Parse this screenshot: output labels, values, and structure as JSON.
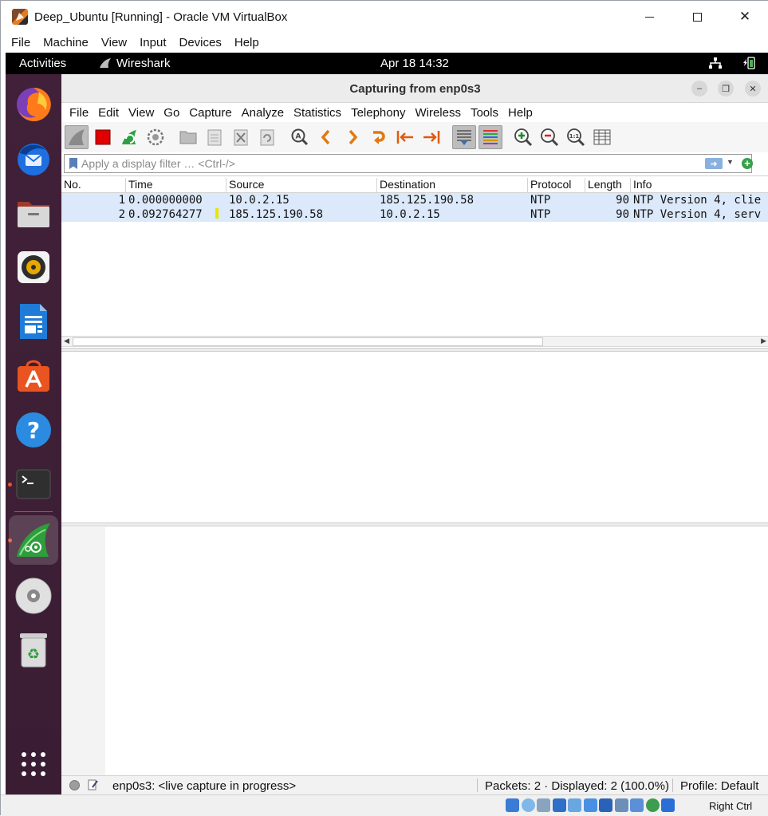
{
  "vbox": {
    "title": "Deep_Ubuntu [Running] - Oracle VM VirtualBox",
    "menu": [
      "File",
      "Machine",
      "View",
      "Input",
      "Devices",
      "Help"
    ],
    "status_right": "Right Ctrl"
  },
  "gnome": {
    "activities": "Activities",
    "app_name": "Wireshark",
    "clock": "Apr 18  14:32"
  },
  "dock": {
    "items": [
      "firefox-icon",
      "thunderbird-icon",
      "files-icon",
      "rhythmbox-icon",
      "writer-icon",
      "app-center-icon",
      "help-icon",
      "terminal-icon",
      "wireshark-icon",
      "disc-icon",
      "trash-icon",
      "show-apps-icon"
    ]
  },
  "wireshark": {
    "title": "Capturing from enp0s3",
    "menu": [
      "File",
      "Edit",
      "View",
      "Go",
      "Capture",
      "Analyze",
      "Statistics",
      "Telephony",
      "Wireless",
      "Tools",
      "Help"
    ],
    "filter_placeholder": "Apply a display filter … <Ctrl-/>",
    "columns": [
      "No.",
      "Time",
      "Source",
      "Destination",
      "Protocol",
      "Length",
      "Info"
    ],
    "packets": [
      {
        "no": "1",
        "time": "0.000000000",
        "source": "10.0.2.15",
        "destination": "185.125.190.58",
        "protocol": "NTP",
        "length": "90",
        "info": "NTP Version 4, clie"
      },
      {
        "no": "2",
        "time": "0.092764277",
        "source": "185.125.190.58",
        "destination": "10.0.2.15",
        "protocol": "NTP",
        "length": "90",
        "info": "NTP Version 4, serv"
      }
    ],
    "status": {
      "capture": "enp0s3: <live capture in progress>",
      "packets": "Packets: 2 · Displayed: 2 (100.0%)",
      "profile": "Profile: Default"
    }
  },
  "colors": {
    "dock_bg": "#3a1d33",
    "row_selected": "#dbe9fa",
    "ubuntu_orange": "#e95420"
  }
}
